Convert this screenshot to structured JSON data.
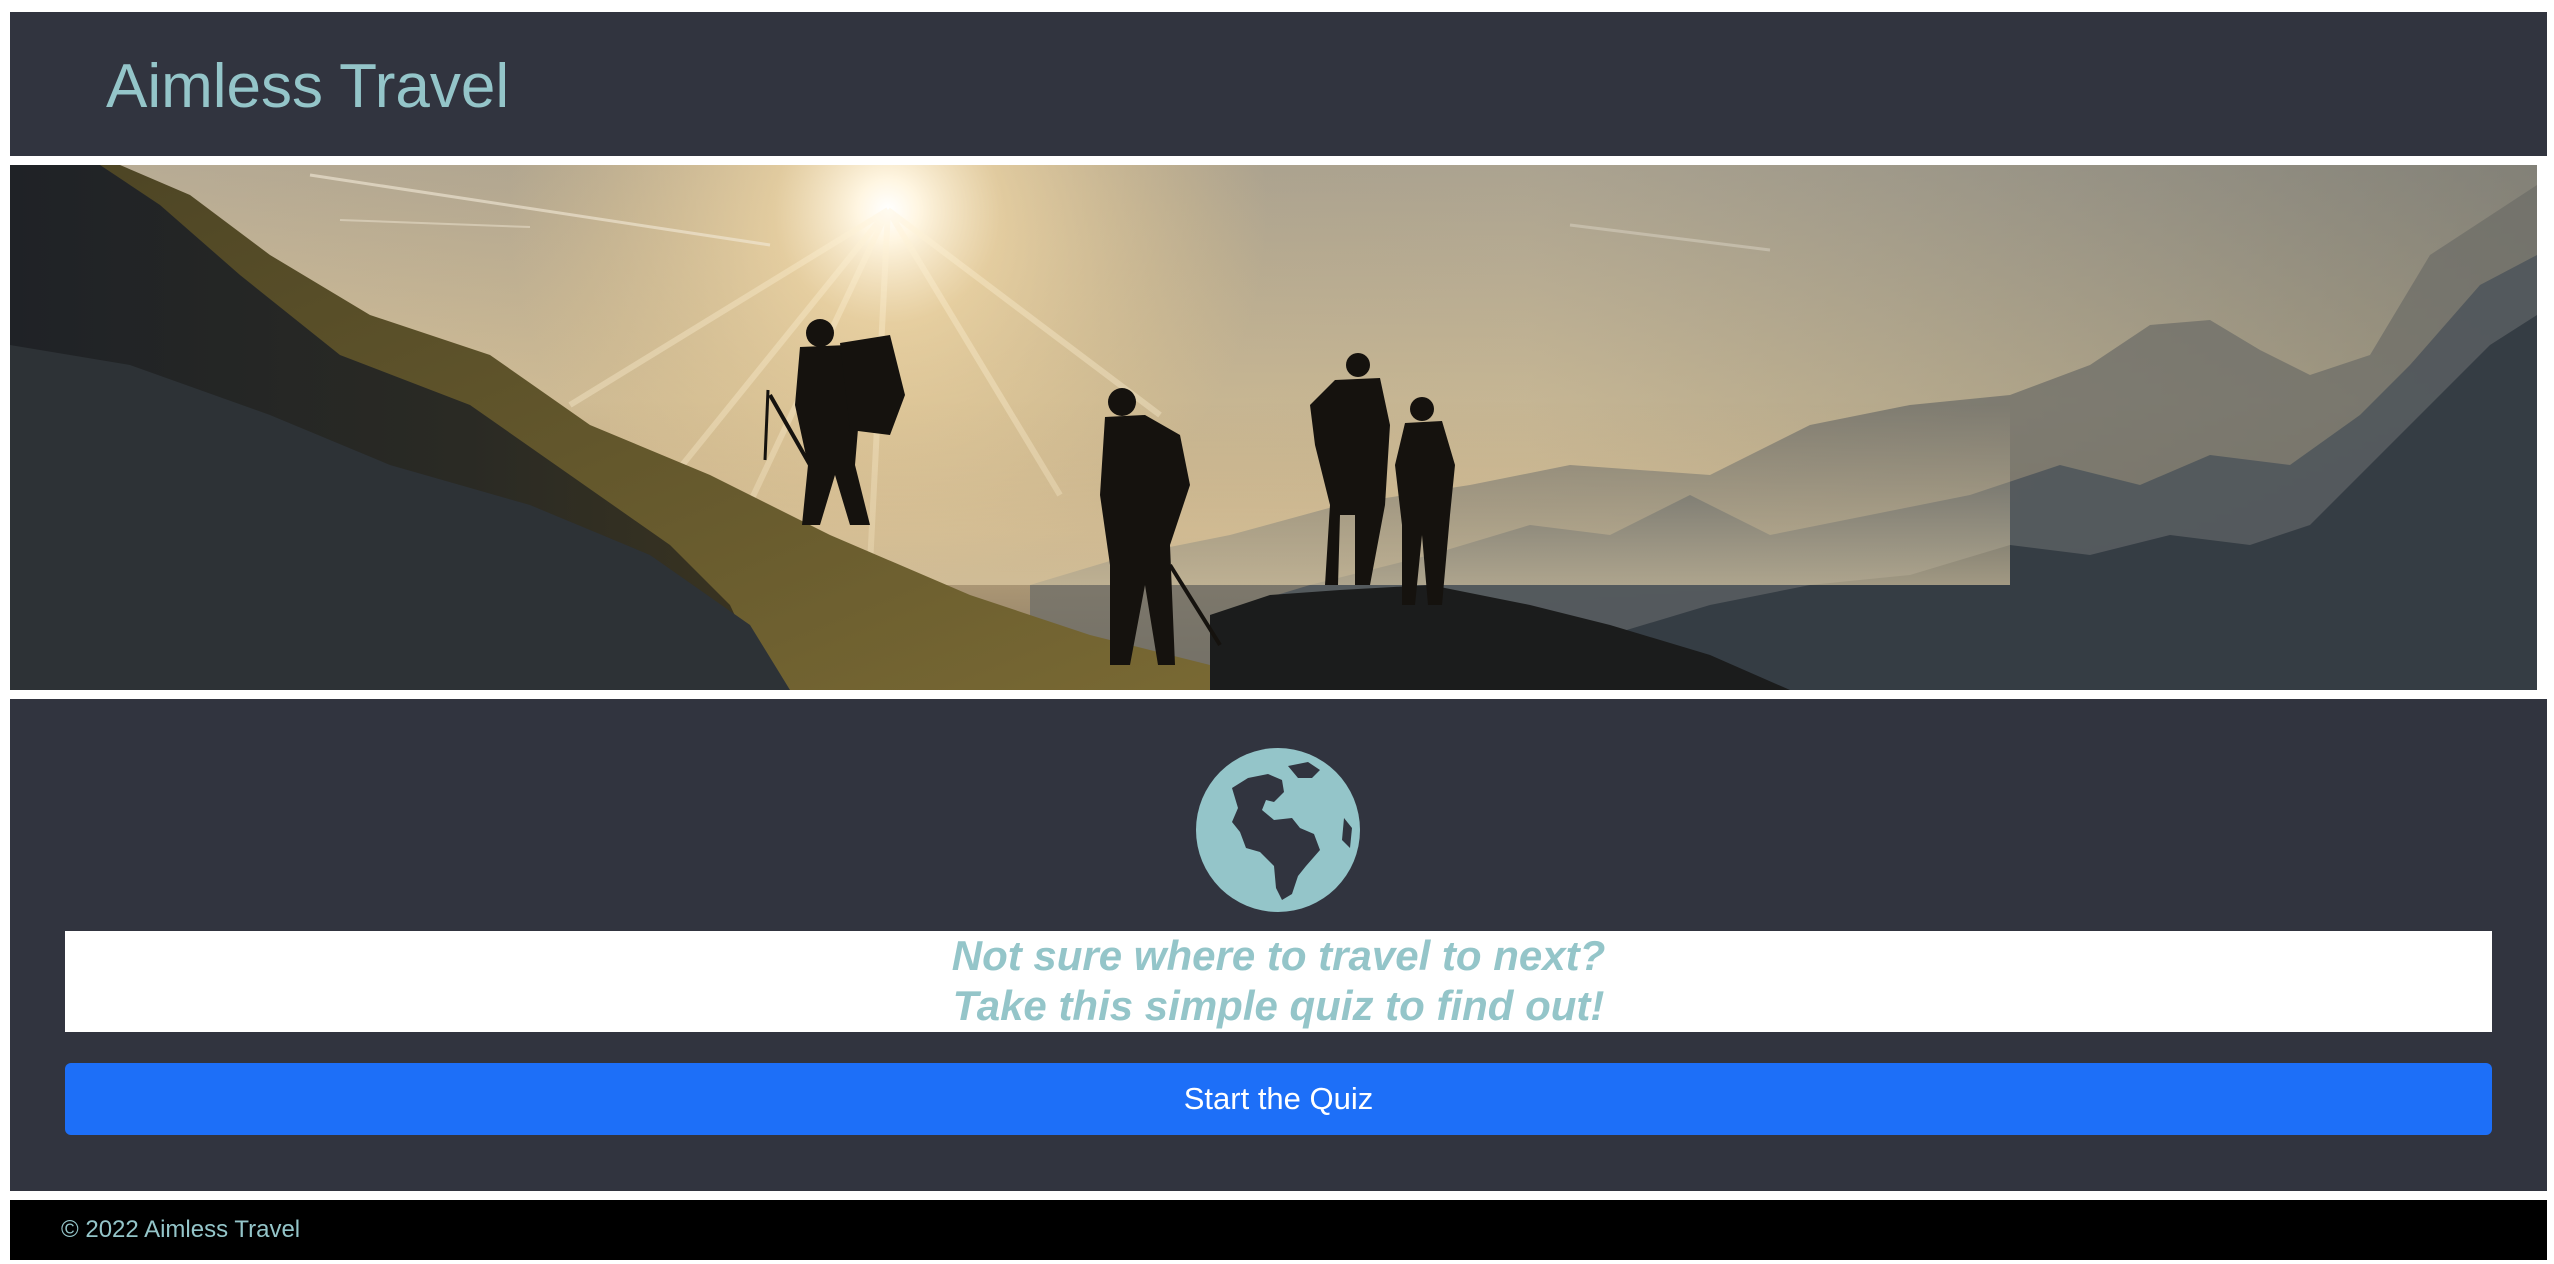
{
  "header": {
    "title": "Aimless Travel"
  },
  "hero": {
    "image": "hikers-on-mountain-at-sunset-photo"
  },
  "main": {
    "icon": "globe-icon",
    "prompt_line1": "Not sure where to travel to next?",
    "prompt_line2": "Take this simple quiz to find out!",
    "start_button_label": "Start the Quiz"
  },
  "footer": {
    "copyright": "© 2022 Aimless Travel"
  },
  "colors": {
    "panel": "#31343f",
    "accent": "#94c5c9",
    "button": "#1d6ff8",
    "footer": "#000000"
  }
}
